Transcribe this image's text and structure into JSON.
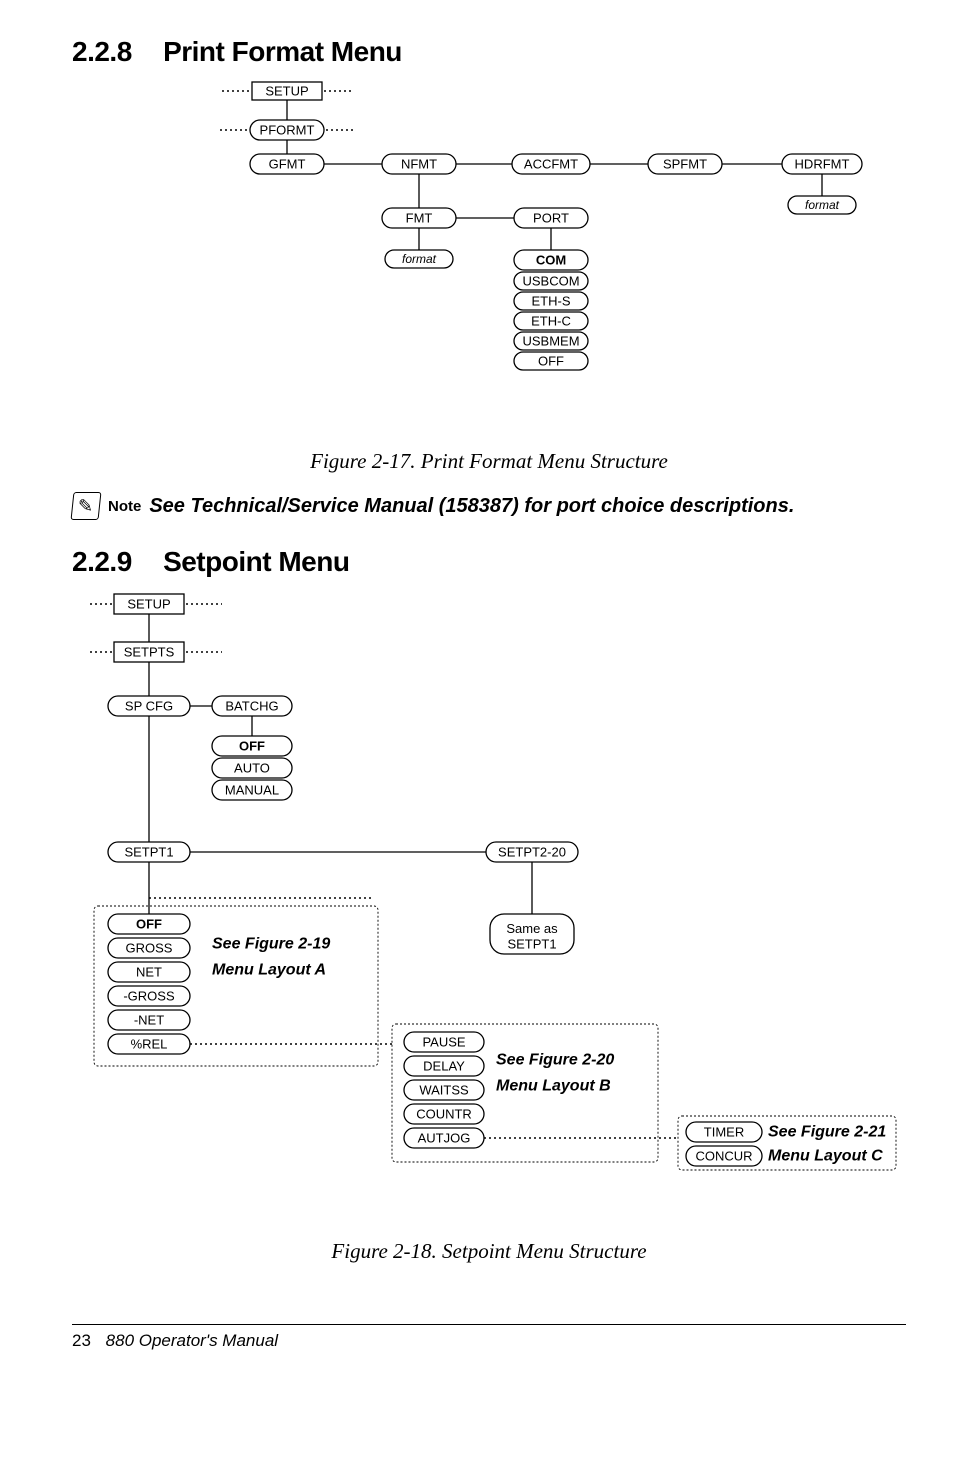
{
  "section1": {
    "num": "2.2.8",
    "title": "Print Format Menu"
  },
  "section2": {
    "num": "2.2.9",
    "title": "Setpoint Menu"
  },
  "fig1": {
    "setup": "SETUP",
    "pformt": "PFORMT",
    "gfmt": "GFMT",
    "nfmt": "NFMT",
    "accfmt": "ACCFMT",
    "spfmt": "SPFMT",
    "hdrfmt": "HDRFMT",
    "fmt": "FMT",
    "port": "PORT",
    "format_left": "format",
    "format_right": "format",
    "com": "COM",
    "usbcom": "USBCOM",
    "eths": "ETH-S",
    "ethc": "ETH-C",
    "usbmem": "USBMEM",
    "off": "OFF",
    "caption": "Figure 2-17. Print Format Menu Structure"
  },
  "note": {
    "label": "Note",
    "text": "See Technical/Service Manual (158387) for port choice descriptions."
  },
  "fig2": {
    "setup": "SETUP",
    "setpts": "SETPTS",
    "spcfg": "SP CFG",
    "batchg": "BATCHG",
    "off": "OFF",
    "auto": "AUTO",
    "manual": "MANUAL",
    "setpt1": "SETPT1",
    "setpt220": "SETPT2-20",
    "sameas": "Same as\nSETPT1",
    "a_off": "OFF",
    "a_gross": "GROSS",
    "a_net": "NET",
    "a_mgross": "-GROSS",
    "a_mnet": "-NET",
    "a_prel": "%REL",
    "refA_l1": "See Figure 2-19",
    "refA_l2": "Menu Layout A",
    "b_pause": "PAUSE",
    "b_delay": "DELAY",
    "b_waitss": "WAITSS",
    "b_countr": "COUNTR",
    "b_autjog": "AUTJOG",
    "refB_l1": "See Figure 2-20",
    "refB_l2": "Menu Layout B",
    "c_timer": "TIMER",
    "c_concur": "CONCUR",
    "refC_l1": "See Figure 2-21",
    "refC_l2": "Menu Layout C",
    "caption": "Figure 2-18. Setpoint Menu Structure"
  },
  "footer": {
    "page": "23",
    "title": "880 Operator's  Manual"
  }
}
